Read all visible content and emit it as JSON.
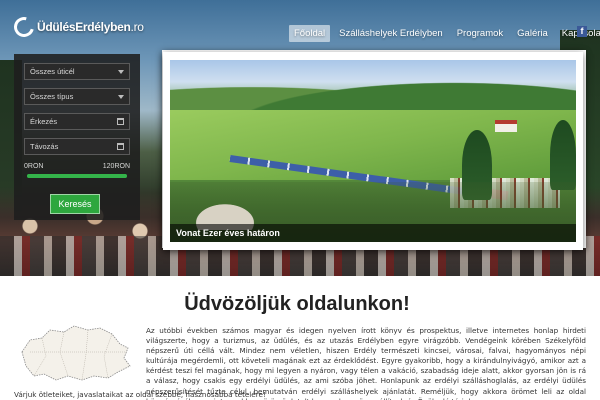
{
  "site": {
    "logo_text_bold": "ÜdülésErdélyben",
    "logo_text_suffix": ".ro"
  },
  "nav": {
    "items": [
      {
        "label": "Főoldal",
        "active": true
      },
      {
        "label": "Szálláshelyek Erdélyben",
        "active": false
      },
      {
        "label": "Programok",
        "active": false
      },
      {
        "label": "Galéria",
        "active": false
      },
      {
        "label": "Kapcsolat",
        "active": false
      }
    ],
    "social_icon": "facebook-icon"
  },
  "search": {
    "destination": "Összes úticél",
    "type": "Összes típus",
    "arrival": "Érkezés",
    "departure": "Távozás",
    "price_min": "0RON",
    "price_max": "120RON",
    "price_slider_fraction": 1.0,
    "button": "Keresés"
  },
  "slider": {
    "caption": "Vonat Ezer éves határon"
  },
  "content": {
    "heading": "Üdvözöljük oldalunkon!",
    "intro": "Az utóbbi években számos magyar és idegen nyelven írott könyv és prospektus, illetve internetes honlap hirdeti világszerte, hogy a turizmus, az üdülés, és az utazás Erdélyben egyre virágzóbb. Vendégeink körében Székelyföld népszerű úti céllá vált. Mindez nem véletlen, hiszen Erdély természeti kincsei, városai, falvai, hagyományos népi kultúrája megérdemli, ott követeli magának ezt az érdeklődést. Egyre gyakoribb, hogy a kirándulnyivágyó, amikor azt a kérdést teszi fel magának, hogy mi legyen a nyáron, vagy télen a vakáció, szabadság ideje alatt, akkor gyorsan jön is rá a válasz, hogy csakis egy erdélyi üdülés, az ami szóba jöhet. Honlapunk az erdélyi szálláshoglalás, az erdélyi üdülés népszerűsítését tűzte célul, bemutatván erdélyi szálláshelyek ajánlatát. Reméljük, hogy akkora örömet leli az oldal böngészésében, mint amekkora örömünk telt benne, hogy összeállítsuk és Önök elé tárjuk.",
    "intro_tail": "Várjuk ötleteiket, javaslataikat az oldal szebbé, hasznosabbá tételére!"
  }
}
